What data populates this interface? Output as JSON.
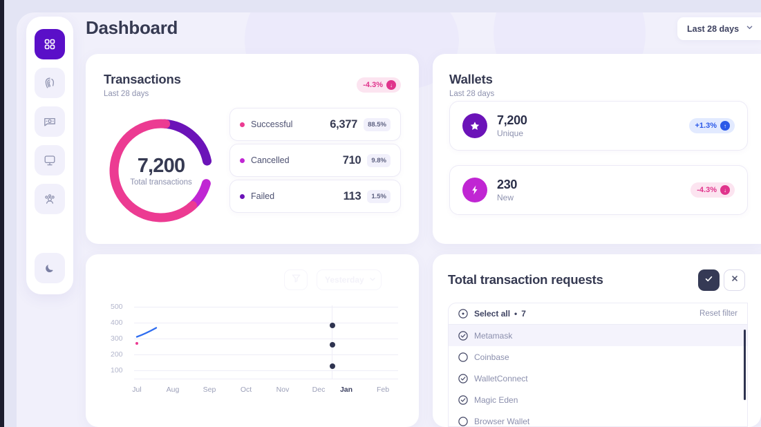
{
  "header": {
    "title": "Dashboard",
    "range_label": "Last 28 days",
    "chevron": "chevron-down"
  },
  "sidebar": {
    "items": [
      {
        "name": "dashboard",
        "icon": "grid-icon",
        "active": true
      },
      {
        "name": "biometrics",
        "icon": "fingerprint-icon",
        "active": false
      },
      {
        "name": "payments",
        "icon": "card-payment-icon",
        "active": false
      },
      {
        "name": "devices",
        "icon": "monitor-icon",
        "active": false
      },
      {
        "name": "users",
        "icon": "users-group-icon",
        "active": false
      }
    ],
    "theme_toggle": {
      "name": "dark-mode",
      "icon": "moon-icon"
    }
  },
  "transactions_card": {
    "title": "Transactions",
    "subtitle": "Last 28 days",
    "badge": {
      "value": "-4.3%",
      "direction": "down",
      "arrow": "↓",
      "color": "#e0348c"
    },
    "donut": {
      "total_value": "7,200",
      "total_label": "Total transactions"
    },
    "legend": [
      {
        "label": "Successful",
        "value": "6,377",
        "pct": "88.5%",
        "color": "#ec3b92"
      },
      {
        "label": "Cancelled",
        "value": "710",
        "pct": "9.8%",
        "color": "#c026d3"
      },
      {
        "label": "Failed",
        "value": "113",
        "pct": "1.5%",
        "color": "#6b13b8"
      }
    ]
  },
  "wallets_card": {
    "title": "Wallets",
    "subtitle": "Last 28 days",
    "rows": [
      {
        "icon": "star-icon",
        "icon_bg": "#6b13b8",
        "value": "7,200",
        "sub": "Unique",
        "badge": {
          "value": "+1.3%",
          "direction": "up",
          "arrow": "↑",
          "color": "#2b59e8"
        }
      },
      {
        "icon": "lightning-bolt-icon",
        "icon_bg": "#c026d3",
        "value": "230",
        "sub": "New",
        "badge": {
          "value": "-4.3%",
          "direction": "down",
          "arrow": "↓",
          "color": "#e0348c"
        }
      }
    ]
  },
  "chart_card": {
    "filter_icon": "funnel-icon",
    "dropdown_label": "Yesterday",
    "dropdown_chevron": "chevron-down"
  },
  "requests_card": {
    "title": "Total transaction requests",
    "confirm_icon": "check-icon",
    "dismiss_icon": "close-icon",
    "select_all_label": "Select all",
    "select_all_separator": "•",
    "select_all_count": "7",
    "reset_label": "Reset filter",
    "items": [
      {
        "label": "Metamask",
        "checked": true,
        "highlighted": true
      },
      {
        "label": "Coinbase",
        "checked": false,
        "highlighted": false
      },
      {
        "label": "WalletConnect",
        "checked": true,
        "highlighted": false
      },
      {
        "label": "Magic Eden",
        "checked": true,
        "highlighted": false
      },
      {
        "label": "Browser Wallet",
        "checked": false,
        "highlighted": false
      }
    ]
  },
  "chart_data": [
    {
      "type": "pie",
      "title": "Transactions",
      "subtitle": "Last 28 days",
      "labels": [
        "Successful",
        "Cancelled",
        "Failed"
      ],
      "values": [
        6377,
        710,
        113
      ],
      "percentages": [
        88.5,
        9.8,
        1.5
      ],
      "colors": [
        "#ec3b92",
        "#c026d3",
        "#6b13b8"
      ],
      "total": 7200,
      "center_label": "Total transactions",
      "legend": "right",
      "donut": true
    },
    {
      "type": "scatter",
      "title": "",
      "xlabel": "",
      "ylabel": "",
      "x": [
        "Jul",
        "Aug",
        "Sep",
        "Oct",
        "Nov",
        "Dec",
        "Jan",
        "Feb"
      ],
      "ylim": [
        0,
        500
      ],
      "yticks": [
        100,
        200,
        300,
        400,
        500
      ],
      "grid": true,
      "series": [
        {
          "name": "trend-line",
          "type": "line",
          "color": "#2f6df0",
          "points": [
            {
              "x": "Jul",
              "y": 288
            },
            {
              "x": "Jul+",
              "y": 322
            }
          ]
        },
        {
          "name": "jan-points",
          "type": "scatter",
          "color": "#2f3450",
          "points": [
            {
              "x": "Jan",
              "y": 365
            },
            {
              "x": "Jan",
              "y": 245
            },
            {
              "x": "Jan",
              "y": 112
            }
          ]
        },
        {
          "name": "origin-marker",
          "type": "scatter",
          "color": "#ec3b92",
          "points": [
            {
              "x": "Jul",
              "y": 258
            }
          ]
        }
      ],
      "highlight_x": "Jan"
    }
  ]
}
